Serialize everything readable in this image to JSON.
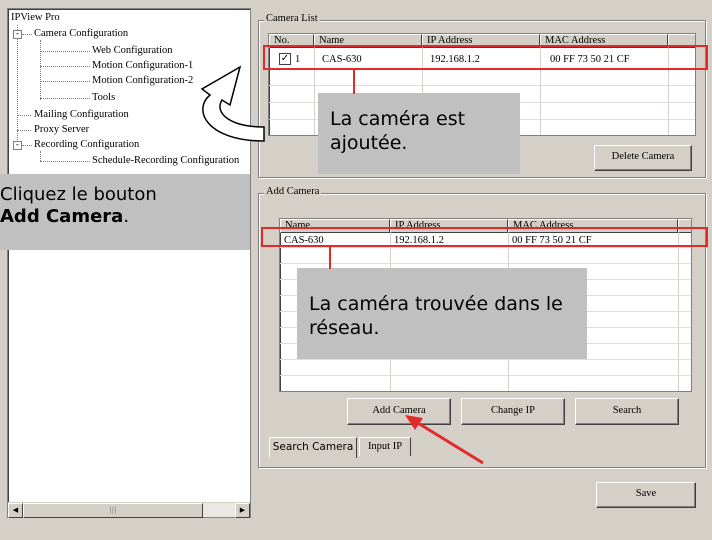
{
  "tree": {
    "root": "IPView Pro",
    "camera_configuration": "Camera Configuration",
    "web_configuration": "Web Configuration",
    "motion_configuration_1": "Motion Configuration-1",
    "motion_configuration_2": "Motion Configuration-2",
    "tools": "Tools",
    "mailing_configuration": "Mailing Configuration",
    "proxy_server": "Proxy Server",
    "recording_configuration": "Recording Configuration",
    "schedule_recording": "Schedule-Recording Configuration",
    "scroll_left": "◀",
    "scroll_right": "▶",
    "scroll_thumb": "|||"
  },
  "camera_list": {
    "title": "Camera List",
    "columns": [
      "No.",
      "Name",
      "IP Address",
      "MAC Address"
    ],
    "rows": [
      {
        "checked": true,
        "no": "1",
        "name": "CAS-630",
        "ip": "192.168.1.2",
        "mac": "00 FF 73 50 21 CF"
      }
    ],
    "delete_button": "Delete Camera"
  },
  "add_camera": {
    "title": "Add Camera",
    "columns": [
      "Name",
      "IP Address",
      "MAC Address"
    ],
    "rows": [
      {
        "name": "CAS-630",
        "ip": "192.168.1.2",
        "mac": "00 FF 73 50 21 CF"
      }
    ],
    "add_button": "Add Camera",
    "change_ip_button": "Change IP",
    "search_button": "Search",
    "tabs": [
      "Search Camera",
      "Input IP"
    ]
  },
  "save_button": "Save",
  "annotations": {
    "click_add_prefix": "Cliquez le bouton",
    "click_add_bold": "Add Camera",
    "click_add_suffix": ".",
    "camera_added": "La caméra est ajoutée.",
    "camera_found": "La caméra trouvée dans le réseau."
  },
  "colors": {
    "annotation_red": "#e32a2a",
    "callout_gray": "#c0c0c0",
    "window_bg": "#d4d0c8"
  }
}
